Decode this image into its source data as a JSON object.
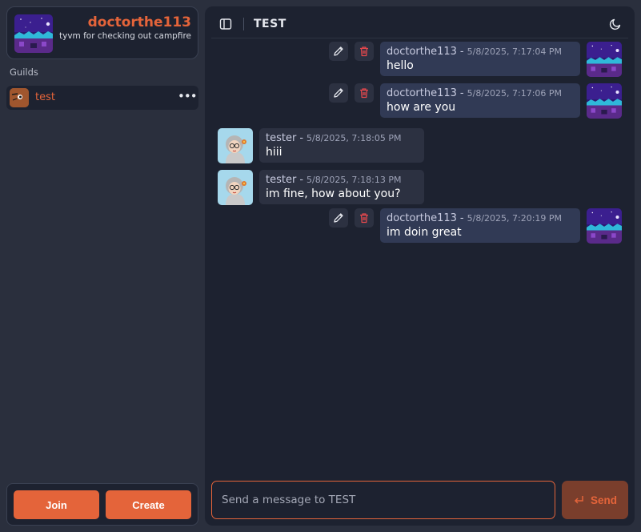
{
  "profile": {
    "username": "doctorthe113",
    "status": "tyvm for checking out campfire"
  },
  "sidebar": {
    "guilds_label": "Guilds",
    "guilds": [
      {
        "name": "test",
        "more": "•••"
      }
    ],
    "join_label": "Join",
    "create_label": "Create"
  },
  "channel": {
    "title": "TEST"
  },
  "messages": [
    {
      "author": "doctorthe113",
      "separator": "-",
      "timestamp": "5/8/2025, 7:17:04 PM",
      "text": "hello",
      "own": true
    },
    {
      "author": "doctorthe113",
      "separator": "-",
      "timestamp": "5/8/2025, 7:17:06 PM",
      "text": "how are you",
      "own": true
    },
    {
      "author": "tester",
      "separator": "-",
      "timestamp": "5/8/2025, 7:18:05 PM",
      "text": "hiii",
      "own": false
    },
    {
      "author": "tester",
      "separator": "-",
      "timestamp": "5/8/2025, 7:18:13 PM",
      "text": "im fine, how about you?",
      "own": false
    },
    {
      "author": "doctorthe113",
      "separator": "-",
      "timestamp": "5/8/2025, 7:20:19 PM",
      "text": "im doin great",
      "own": true
    }
  ],
  "composer": {
    "placeholder": "Send a message to TEST",
    "send_label": "Send"
  },
  "colors": {
    "accent": "#e4643a",
    "panel": "#1d2230",
    "background": "#2a2f3d"
  }
}
